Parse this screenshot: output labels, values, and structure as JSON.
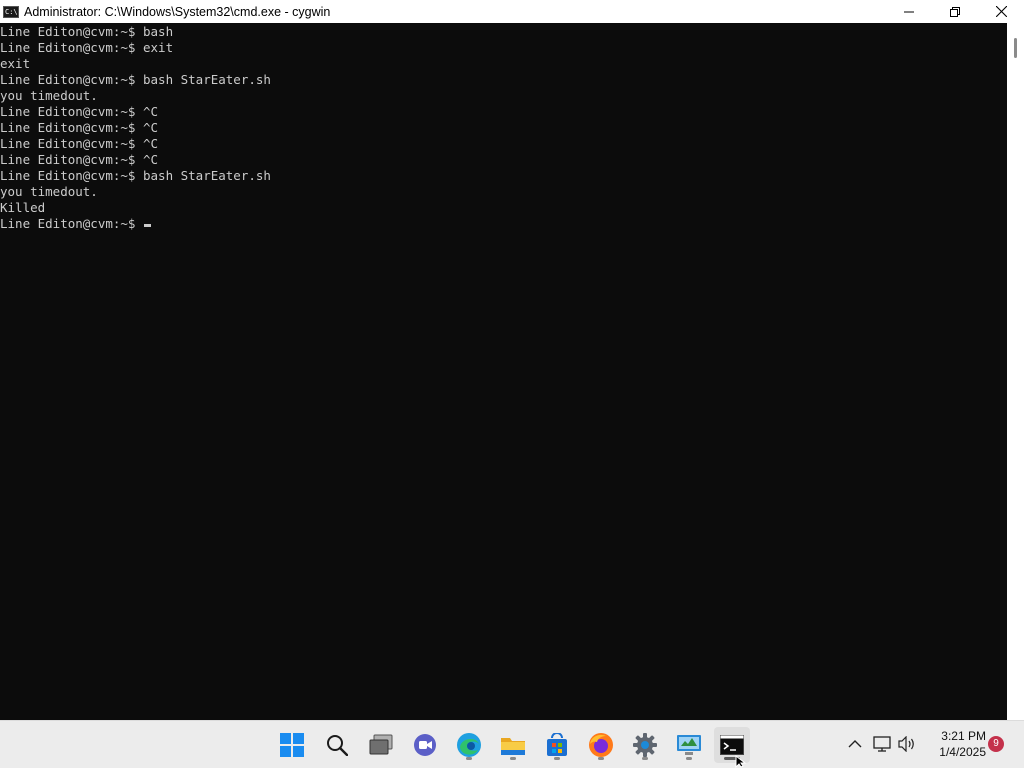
{
  "window": {
    "title": "Administrator: C:\\Windows\\System32\\cmd.exe - cygwin",
    "icon_label": "C:\\",
    "controls": {
      "minimize": "minimize-icon",
      "restore": "restore-icon",
      "close": "close-icon"
    }
  },
  "console": {
    "text_color": "#cccccc",
    "background": "#0c0c0c",
    "lines": [
      "Line Editon@cvm:~$ bash",
      "Line Editon@cvm:~$ exit",
      "exit",
      "Line Editon@cvm:~$ bash StarEater.sh",
      "you timedout.",
      "Line Editon@cvm:~$ ^C",
      "Line Editon@cvm:~$ ^C",
      "Line Editon@cvm:~$ ^C",
      "Line Editon@cvm:~$ ^C",
      "Line Editon@cvm:~$ bash StarEater.sh",
      "you timedout.",
      "Killed"
    ],
    "prompt": "Line Editon@cvm:~$ "
  },
  "taskbar": {
    "apps": [
      {
        "name": "start",
        "icon": "windows-start-icon"
      },
      {
        "name": "search",
        "icon": "search-icon"
      },
      {
        "name": "task-view",
        "icon": "task-view-icon"
      },
      {
        "name": "meet",
        "icon": "video-chat-icon"
      },
      {
        "name": "edge",
        "icon": "edge-browser-icon"
      },
      {
        "name": "file-explorer",
        "icon": "folder-icon"
      },
      {
        "name": "store",
        "icon": "store-icon"
      },
      {
        "name": "firefox",
        "icon": "firefox-icon"
      },
      {
        "name": "settings",
        "icon": "gear-icon"
      },
      {
        "name": "control-panel",
        "icon": "control-panel-icon"
      },
      {
        "name": "terminal",
        "icon": "terminal-icon",
        "active": true
      }
    ],
    "tray": {
      "icons": [
        "chevron-up-icon",
        "network-icon",
        "volume-icon"
      ],
      "time": "3:21 PM",
      "date": "1/4/2025",
      "notification_count": "9"
    }
  }
}
